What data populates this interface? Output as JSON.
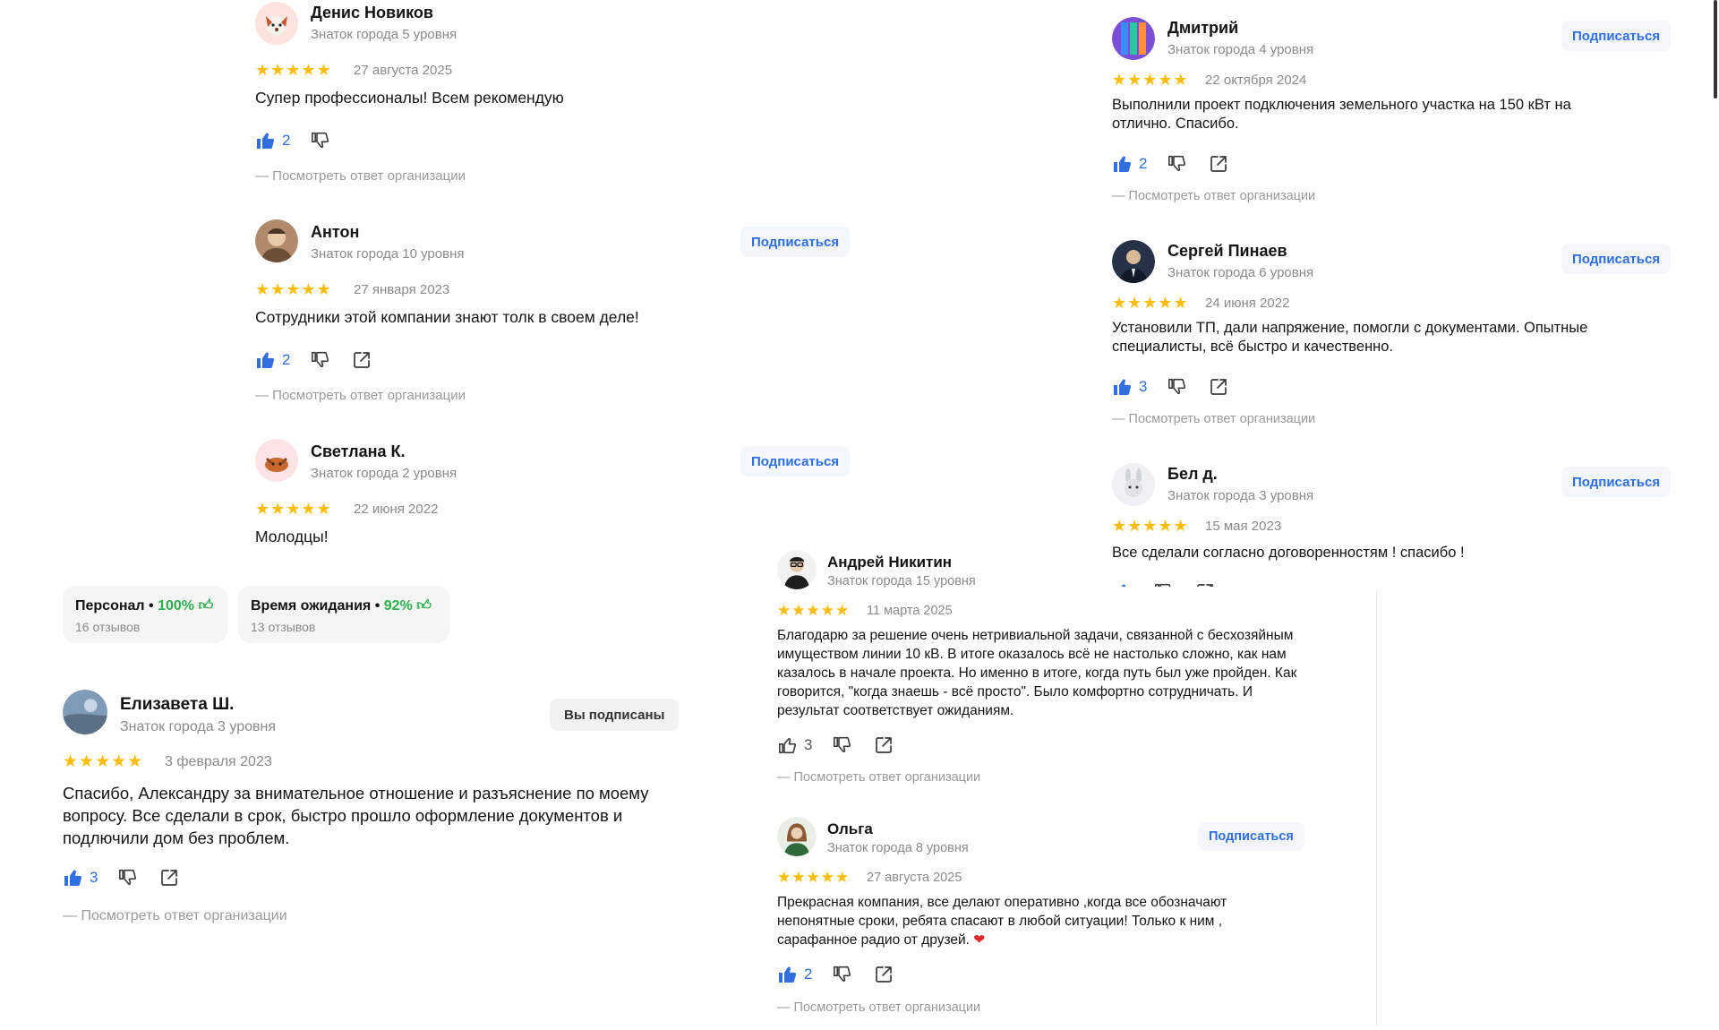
{
  "reviews": [
    {
      "name": "Денис Новиков",
      "level": "Знаток города 5 уровня",
      "stars": "★★★★★",
      "date": "27 августа 2025",
      "text": "Супер профессионалы! Всем рекомендую",
      "likes": "2",
      "reply": "— Посмотреть ответ организации"
    },
    {
      "name": "Антон",
      "level": "Знаток города 10 уровня",
      "stars": "★★★★★",
      "date": "27 января 2023",
      "text": "Сотрудники этой компании знают толк в своем деле!",
      "likes": "2",
      "reply": "— Посмотреть ответ организации",
      "subscribe": "Подписаться"
    },
    {
      "name": "Светлана К.",
      "level": "Знаток города 2 уровня",
      "stars": "★★★★★",
      "date": "22 июня 2022",
      "text": "Молодцы!",
      "subscribe": "Подписаться"
    },
    {
      "name": "Елизавета Ш.",
      "level": "Знаток города 3 уровня",
      "stars": "★★★★★",
      "date": "3 февраля 2023",
      "text": "Спасибо, Александру за внимательное отношение и разъяснение по моему вопросу. Все сделали в срок, быстро прошло оформление документов и подлючили дом без проблем.",
      "likes": "3",
      "reply": "— Посмотреть ответ организации",
      "subscribe": "Вы подписаны"
    },
    {
      "name": "Дмитрий",
      "level": "Знаток города 4 уровня",
      "stars": "★★★★★",
      "date": "22 октября 2024",
      "text": "Выполнили проект подключения земельного участка на 150 кВт на отлично. Спасибо.",
      "likes": "2",
      "reply": "— Посмотреть ответ организации",
      "subscribe": "Подписаться"
    },
    {
      "name": "Сергей Пинаев",
      "level": "Знаток города 6 уровня",
      "stars": "★★★★★",
      "date": "24 июня 2022",
      "text": "Установили ТП, дали напряжение, помогли с документами. Опытные специалисты, всё быстро и качественно.",
      "likes": "3",
      "reply": "— Посмотреть ответ организации",
      "subscribe": "Подписаться"
    },
    {
      "name": "Бел д.",
      "level": "Знаток города 3 уровня",
      "stars": "★★★★★",
      "date": "15 мая 2023",
      "text": "Все сделали согласно договоренностям ! спасибо !",
      "subscribe": "Подписаться"
    },
    {
      "name": "Андрей Никитин",
      "level": "Знаток города 15 уровня",
      "stars": "★★★★★",
      "date": "11 марта 2025",
      "text": "Благодарю за решение очень нетривиальной задачи, связанной с бесхозяйным имуществом линии 10 кВ. В итоге оказалось всё не настолько сложно, как нам казалось в начале проекта. Но именно в итоге, когда путь был уже пройден. Как говорится, \"когда знаешь - всё просто\". Было комфортно сотрудничать. И результат соответствует ожиданиям.",
      "likes": "3",
      "reply": "— Посмотреть ответ организации"
    },
    {
      "name": "Ольга",
      "level": "Знаток города 8 уровня",
      "stars": "★★★★★",
      "date": "27 августа 2025",
      "text": "Прекрасная компания, все делают оперативно ,когда все обозначают непонятные сроки, ребята спасают в любой ситуации! Только к ним , сарафанное радио от друзей.",
      "heart": "❤",
      "likes": "2",
      "reply": "— Посмотреть ответ организации",
      "subscribe": "Подписаться"
    }
  ],
  "aspects": [
    {
      "label": "Персонал",
      "percent": "100%",
      "count": "16 отзывов"
    },
    {
      "label": "Время ожидания",
      "percent": "92%",
      "count": "13 отзывов"
    }
  ],
  "colors": {
    "accent": "#2f6fe0",
    "star": "#fbbc04",
    "positive": "#2bb04a",
    "muted": "#8a8a8a"
  },
  "icons": {
    "like": "thumb-up-icon",
    "dislike": "thumb-down-icon",
    "share": "share-icon"
  }
}
